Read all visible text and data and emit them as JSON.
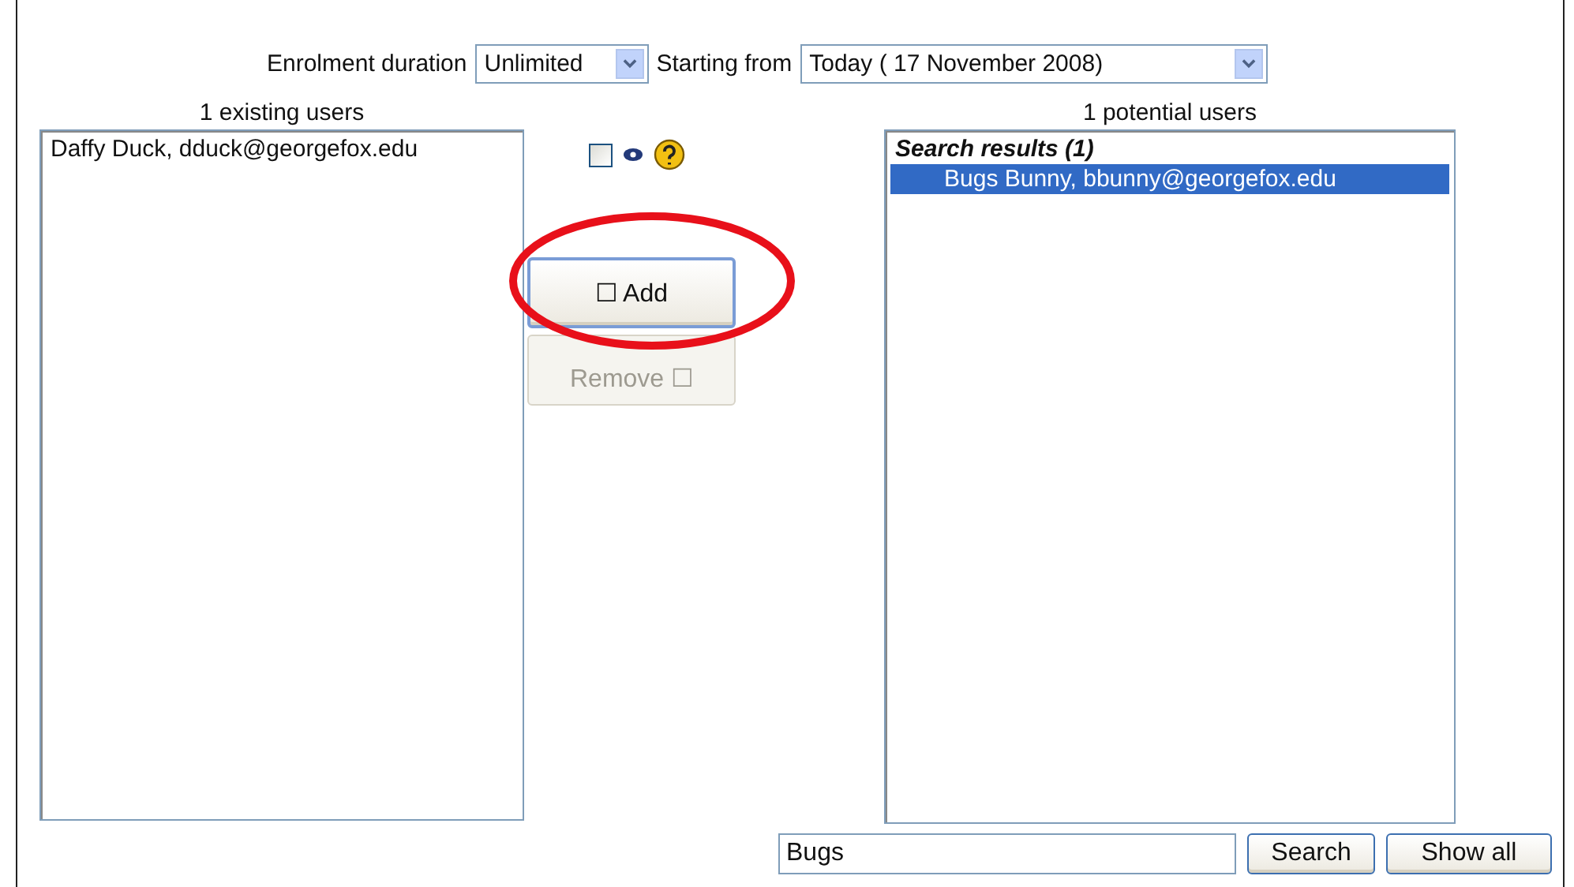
{
  "enrolment": {
    "duration_label": "Enrolment duration",
    "duration_value": "Unlimited",
    "start_label": "Starting from",
    "start_value": "Today ( 17 November 2008)"
  },
  "existing_users": {
    "heading": "1 existing users",
    "items": [
      {
        "text": "Daffy Duck, dduck@georgefox.edu",
        "selected": false
      }
    ]
  },
  "middle": {
    "checkbox": {
      "checked": false
    },
    "buttons": [
      {
        "label": "☐ Add",
        "disabled": false
      },
      {
        "label": "Remove ☐",
        "disabled": true
      }
    ]
  },
  "potential_users": {
    "heading": "1 potential users",
    "groups": [
      {
        "label": "Search results (1)",
        "items": [
          {
            "text": "Bugs Bunny, bbunny@georgefox.edu",
            "selected": true
          }
        ]
      }
    ]
  },
  "search": {
    "value": "Bugs",
    "buttons": [
      "Search",
      "Show all"
    ]
  }
}
